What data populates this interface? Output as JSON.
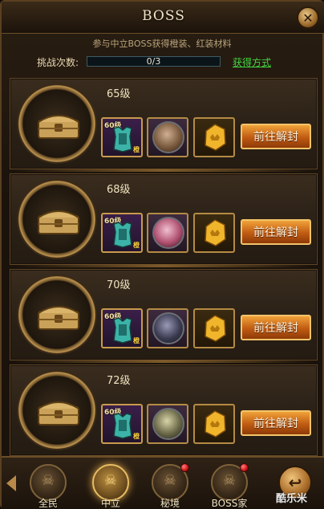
{
  "header": {
    "title": "BOSS",
    "close_icon": "close-icon"
  },
  "info_text": "参与中立BOSS获得橙装、红装材料",
  "challenge": {
    "label": "挑战次数:",
    "progress_text": "0/3",
    "progress_fraction": 0,
    "obtain_link": "获得方式"
  },
  "bosses": [
    {
      "level": "65级",
      "equip_level": "60级",
      "equip_tag": "橙",
      "button": "前往解封",
      "portrait_color": "#7a5a3e"
    },
    {
      "level": "68级",
      "equip_level": "60级",
      "equip_tag": "橙",
      "button": "前往解封",
      "portrait_color": "#b05070"
    },
    {
      "level": "70级",
      "equip_level": "60级",
      "equip_tag": "橙",
      "button": "前往解封",
      "portrait_color": "#3c3c52"
    },
    {
      "level": "72级",
      "equip_level": "60级",
      "equip_tag": "橙",
      "button": "前往解封",
      "portrait_color": "#6a6848"
    }
  ],
  "nav": {
    "tabs": [
      {
        "label": "全民",
        "active": false,
        "badge": false
      },
      {
        "label": "中立",
        "active": true,
        "badge": false
      },
      {
        "label": "秘境",
        "active": false,
        "badge": true
      },
      {
        "label": "BOSS家",
        "active": false,
        "badge": true
      }
    ],
    "back_icon": "return-arrow-icon"
  },
  "watermark": "酷乐米",
  "colors": {
    "accent_orange": "#c05b12",
    "link_green": "#41d641",
    "progress_blue": "#2aa7c4"
  }
}
